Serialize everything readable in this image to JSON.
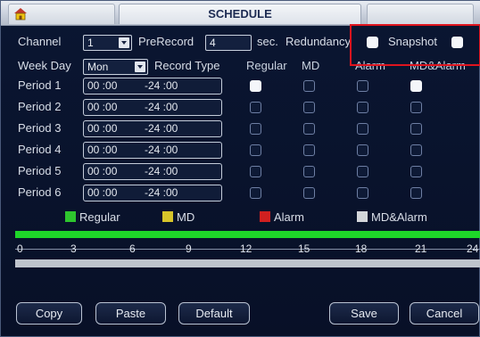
{
  "window": {
    "title": "SCHEDULE"
  },
  "fields": {
    "channel_label": "Channel",
    "channel_value": "1",
    "prerecord_label": "PreRecord",
    "prerecord_value": "4",
    "prerecord_unit": "sec.",
    "redundancy_label": "Redundancy",
    "snapshot_label": "Snapshot",
    "weekday_label": "Week Day",
    "weekday_value": "Mon",
    "record_type_label": "Record Type"
  },
  "columns": [
    "Regular",
    "MD",
    "Alarm",
    "MD&Alarm"
  ],
  "periods": [
    {
      "label": "Period 1",
      "start": "00 :00",
      "end": "-24 :00",
      "regular": true,
      "md": false,
      "alarm": false,
      "mdalarm": true
    },
    {
      "label": "Period 2",
      "start": "00 :00",
      "end": "-24 :00",
      "regular": false,
      "md": false,
      "alarm": false,
      "mdalarm": false
    },
    {
      "label": "Period 3",
      "start": "00 :00",
      "end": "-24 :00",
      "regular": false,
      "md": false,
      "alarm": false,
      "mdalarm": false
    },
    {
      "label": "Period 4",
      "start": "00 :00",
      "end": "-24 :00",
      "regular": false,
      "md": false,
      "alarm": false,
      "mdalarm": false
    },
    {
      "label": "Period 5",
      "start": "00 :00",
      "end": "-24 :00",
      "regular": false,
      "md": false,
      "alarm": false,
      "mdalarm": false
    },
    {
      "label": "Period 6",
      "start": "00 :00",
      "end": "-24 :00",
      "regular": false,
      "md": false,
      "alarm": false,
      "mdalarm": false
    }
  ],
  "legend": [
    {
      "label": "Regular",
      "color": "#2ec52e"
    },
    {
      "label": "MD",
      "color": "#d7c42a"
    },
    {
      "label": "Alarm",
      "color": "#d02020"
    },
    {
      "label": "MD&Alarm",
      "color": "#d4d6da"
    }
  ],
  "timeline": {
    "ticks": [
      "0",
      "3",
      "6",
      "9",
      "12",
      "15",
      "18",
      "21",
      "24"
    ]
  },
  "buttons": {
    "copy": "Copy",
    "paste": "Paste",
    "default": "Default",
    "save": "Save",
    "cancel": "Cancel"
  },
  "colors": {
    "highlight": "#e0141e",
    "timeline_regular": "#1ed629"
  }
}
